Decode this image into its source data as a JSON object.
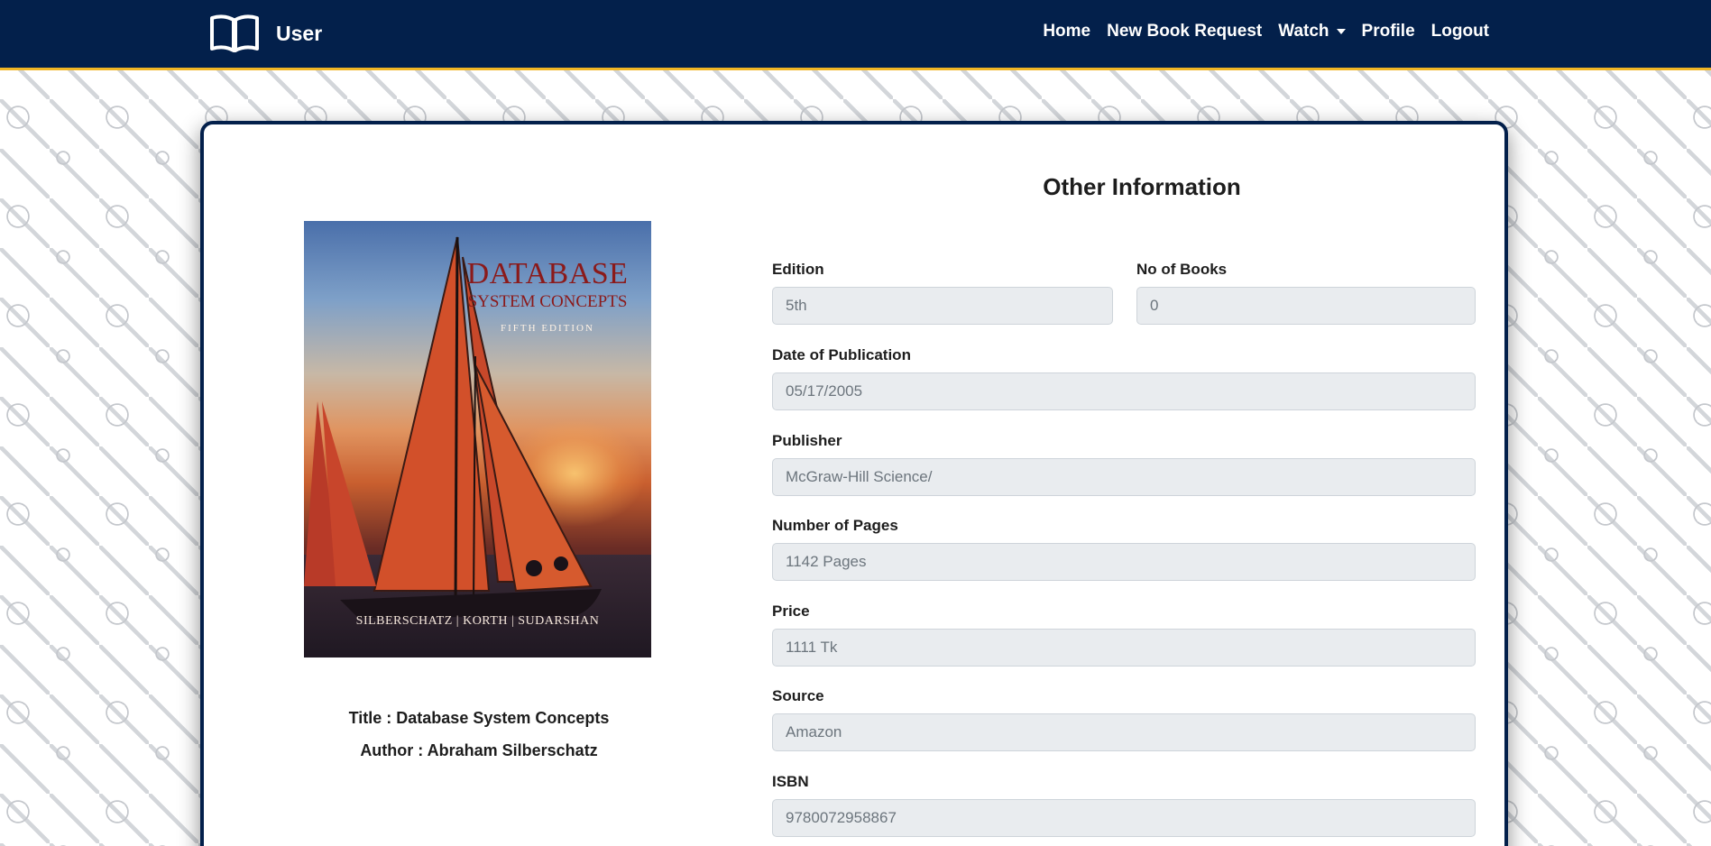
{
  "navbar": {
    "brand_label": "User",
    "links": {
      "home": "Home",
      "new_book_request": "New Book Request",
      "watch": "Watch",
      "profile": "Profile",
      "logout": "Logout"
    }
  },
  "book": {
    "cover": {
      "title": "DATABASE",
      "subtitle": "SYSTEM CONCEPTS",
      "edition": "FIFTH EDITION",
      "authors": "SILBERSCHATZ   |   KORTH   |   SUDARSHAN"
    },
    "title_line": "Title : Database System Concepts",
    "author_line": "Author : Abraham Silberschatz"
  },
  "other_info": {
    "heading": "Other Information",
    "edition": {
      "label": "Edition",
      "value": "5th"
    },
    "no_of_books": {
      "label": "No of Books",
      "value": "0"
    },
    "date_of_publication": {
      "label": "Date of Publication",
      "value": "05/17/2005"
    },
    "publisher": {
      "label": "Publisher",
      "value": "McGraw-Hill Science/"
    },
    "number_of_pages": {
      "label": "Number of Pages",
      "value": "1142 Pages"
    },
    "price": {
      "label": "Price",
      "value": "1111 Tk"
    },
    "source": {
      "label": "Source",
      "value": "Amazon"
    },
    "isbn": {
      "label": "ISBN",
      "value": "9780072958867"
    }
  },
  "colors": {
    "navbar_bg": "#03204b",
    "navbar_accent": "#f1b625",
    "input_bg": "#e9ecef"
  },
  "icons": [
    "open-book-icon",
    "caret-down-icon"
  ]
}
